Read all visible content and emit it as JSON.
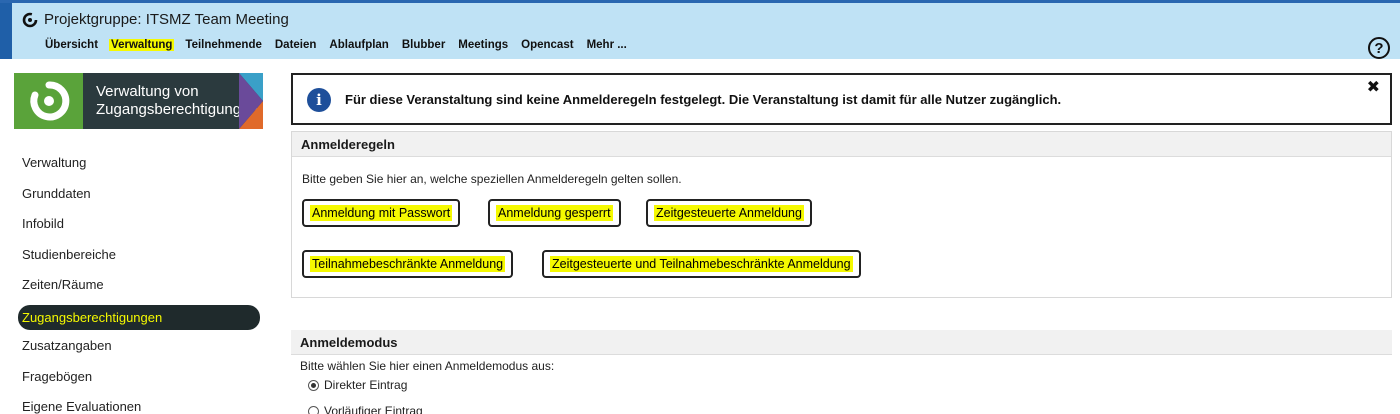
{
  "header": {
    "title": "Projektgruppe: ITSMZ Team Meeting",
    "nav": [
      {
        "label": "Übersicht",
        "active": false
      },
      {
        "label": "Verwaltung",
        "active": true
      },
      {
        "label": "Teilnehmende",
        "active": false
      },
      {
        "label": "Dateien",
        "active": false
      },
      {
        "label": "Ablaufplan",
        "active": false
      },
      {
        "label": "Blubber",
        "active": false
      },
      {
        "label": "Meetings",
        "active": false
      },
      {
        "label": "Opencast",
        "active": false
      },
      {
        "label": "Mehr ...",
        "active": false
      }
    ],
    "help_icon": "?"
  },
  "sidebar": {
    "banner_line1": "Verwaltung von",
    "banner_line2": "Zugangsberechtigungen",
    "items": [
      "Verwaltung",
      "Grunddaten",
      "Infobild",
      "Studienbereiche",
      "Zeiten/Räume",
      "Zugangsberechtigungen",
      "Zusatzangaben",
      "Fragebögen",
      "Eigene Evaluationen"
    ],
    "active_index": 5
  },
  "info": {
    "icon": "i",
    "text": "Für diese Veranstaltung sind keine Anmelderegeln festgelegt. Die Veranstaltung ist damit für alle Nutzer zugänglich.",
    "close": "✖"
  },
  "rules": {
    "title": "Anmelderegeln",
    "description": "Bitte geben Sie hier an, welche speziellen Anmelderegeln gelten sollen.",
    "buttons": [
      "Anmeldung mit Passwort",
      "Anmeldung gesperrt",
      "Zeitgesteuerte Anmeldung",
      "Teilnahmebeschränkte Anmeldung",
      "Zeitgesteuerte und Teilnahmebeschränkte Anmeldung"
    ]
  },
  "modus": {
    "title": "Anmeldemodus",
    "description": "Bitte wählen Sie hier einen Anmeldemodus aus:",
    "options": [
      {
        "label": "Direkter Eintrag",
        "checked": true
      },
      {
        "label": "Vorläufiger Eintrag",
        "checked": false
      }
    ]
  },
  "colors": {
    "header_bg": "#bfe2f5",
    "highlight": "#f5f900",
    "sidebar_active_bg": "#1f2a2c",
    "info_icon": "#1e4f9a",
    "brand_green": "#5aa33a"
  }
}
